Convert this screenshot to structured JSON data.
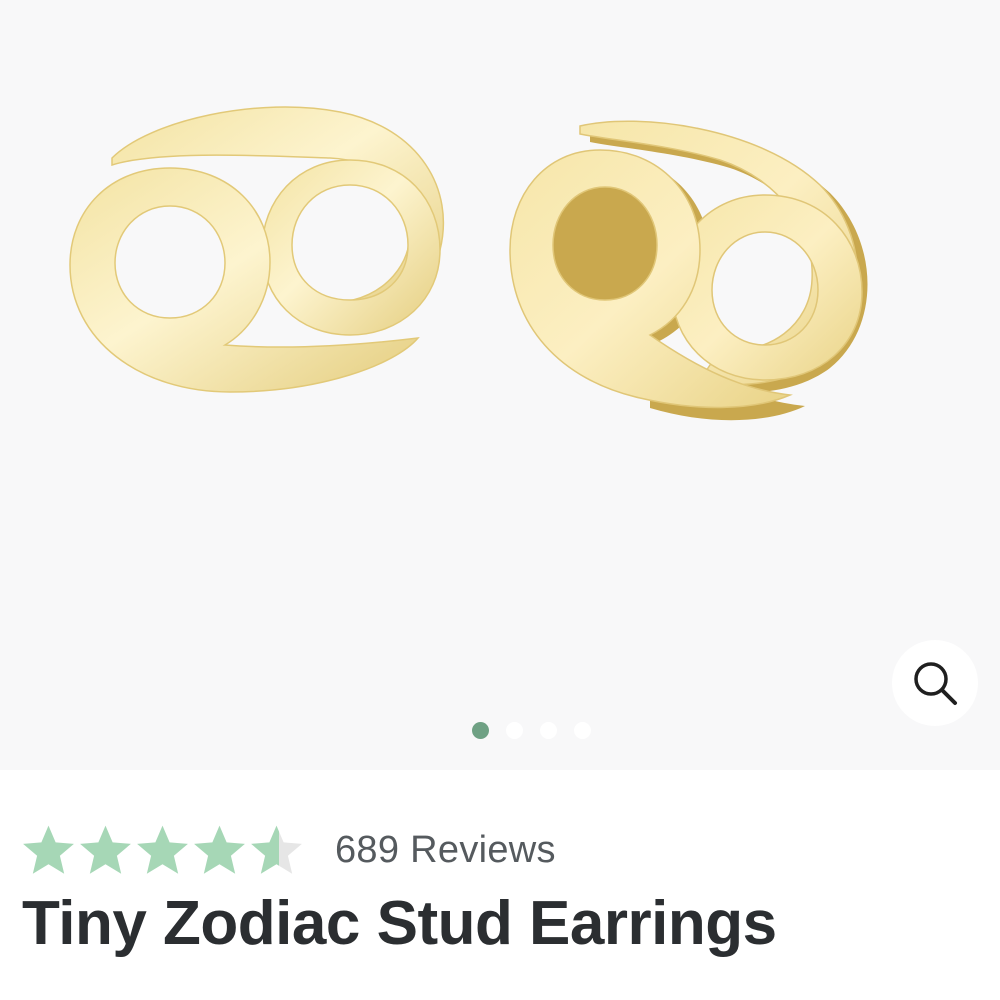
{
  "product": {
    "title": "Tiny Zodiac Stud Earrings",
    "image_icon": "cancer-zodiac-earrings-image",
    "image_colors": {
      "background": "#f8f8f9",
      "gold_light": "#fbefb9",
      "gold_mid": "#ead88a",
      "gold_dark": "#c8a84c"
    }
  },
  "gallery": {
    "slide_count": 4,
    "active_slide": 1,
    "zoom_icon": "magnifier-icon"
  },
  "rating": {
    "value": 4.5,
    "max": 5,
    "star_color": "#a6d7b6",
    "star_empty_color": "#e6e6e6",
    "reviews_text": "689 Reviews"
  }
}
